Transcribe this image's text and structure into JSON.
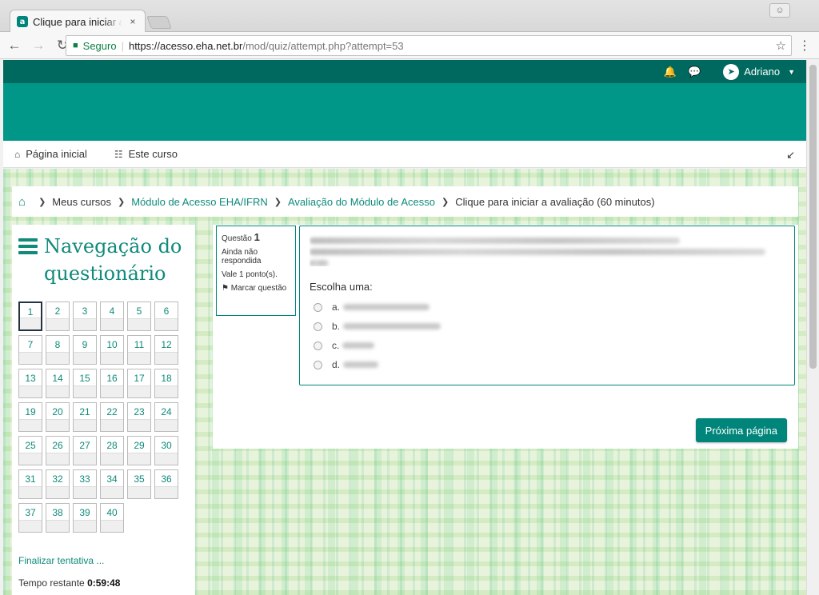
{
  "browser": {
    "tab_title": "Clique para iniciar a avaliação (60 minutos)",
    "tab_close": "×",
    "secure_label": "Seguro",
    "url_host": "https://acesso.eha.net.br",
    "url_path": "/mod/quiz/attempt.php?attempt=53",
    "icons": [
      "back-icon",
      "forward-icon",
      "reload-icon",
      "lock-icon",
      "star-icon",
      "menu-icon"
    ]
  },
  "site": {
    "user_name": "Adriano",
    "nav": {
      "home_label": "Página inicial",
      "course_label": "Este curso"
    },
    "breadcrumb": {
      "my_courses": "Meus cursos",
      "module": "Módulo de Acesso EHA/IFRN",
      "assessment": "Avaliação do Módulo de Acesso",
      "current": "Clique para iniciar a avaliação (60 minutos)"
    },
    "colors": {
      "topbar": "#00695f",
      "banner": "#009688",
      "accent": "#0f8a7b"
    }
  },
  "quiz_nav": {
    "title": "Navegação do questionário",
    "questions": [
      "1",
      "2",
      "3",
      "4",
      "5",
      "6",
      "7",
      "8",
      "9",
      "10",
      "11",
      "12",
      "13",
      "14",
      "15",
      "16",
      "17",
      "18",
      "19",
      "20",
      "21",
      "22",
      "23",
      "24",
      "25",
      "26",
      "27",
      "28",
      "29",
      "30",
      "31",
      "32",
      "33",
      "34",
      "35",
      "36",
      "37",
      "38",
      "39",
      "40"
    ],
    "current": "1",
    "finish_label": "Finalizar tentativa ...",
    "timer_label": "Tempo restante",
    "timer_value": "0:59:48"
  },
  "question": {
    "label": "Questão",
    "number": "1",
    "state": "Ainda não respondida",
    "marks": "Vale 1 ponto(s).",
    "flag_label": "Marcar questão",
    "prompt_choose": "Escolha uma:",
    "options": [
      {
        "letter": "a."
      },
      {
        "letter": "b."
      },
      {
        "letter": "c."
      },
      {
        "letter": "d."
      }
    ],
    "next_label": "Próxima página"
  }
}
